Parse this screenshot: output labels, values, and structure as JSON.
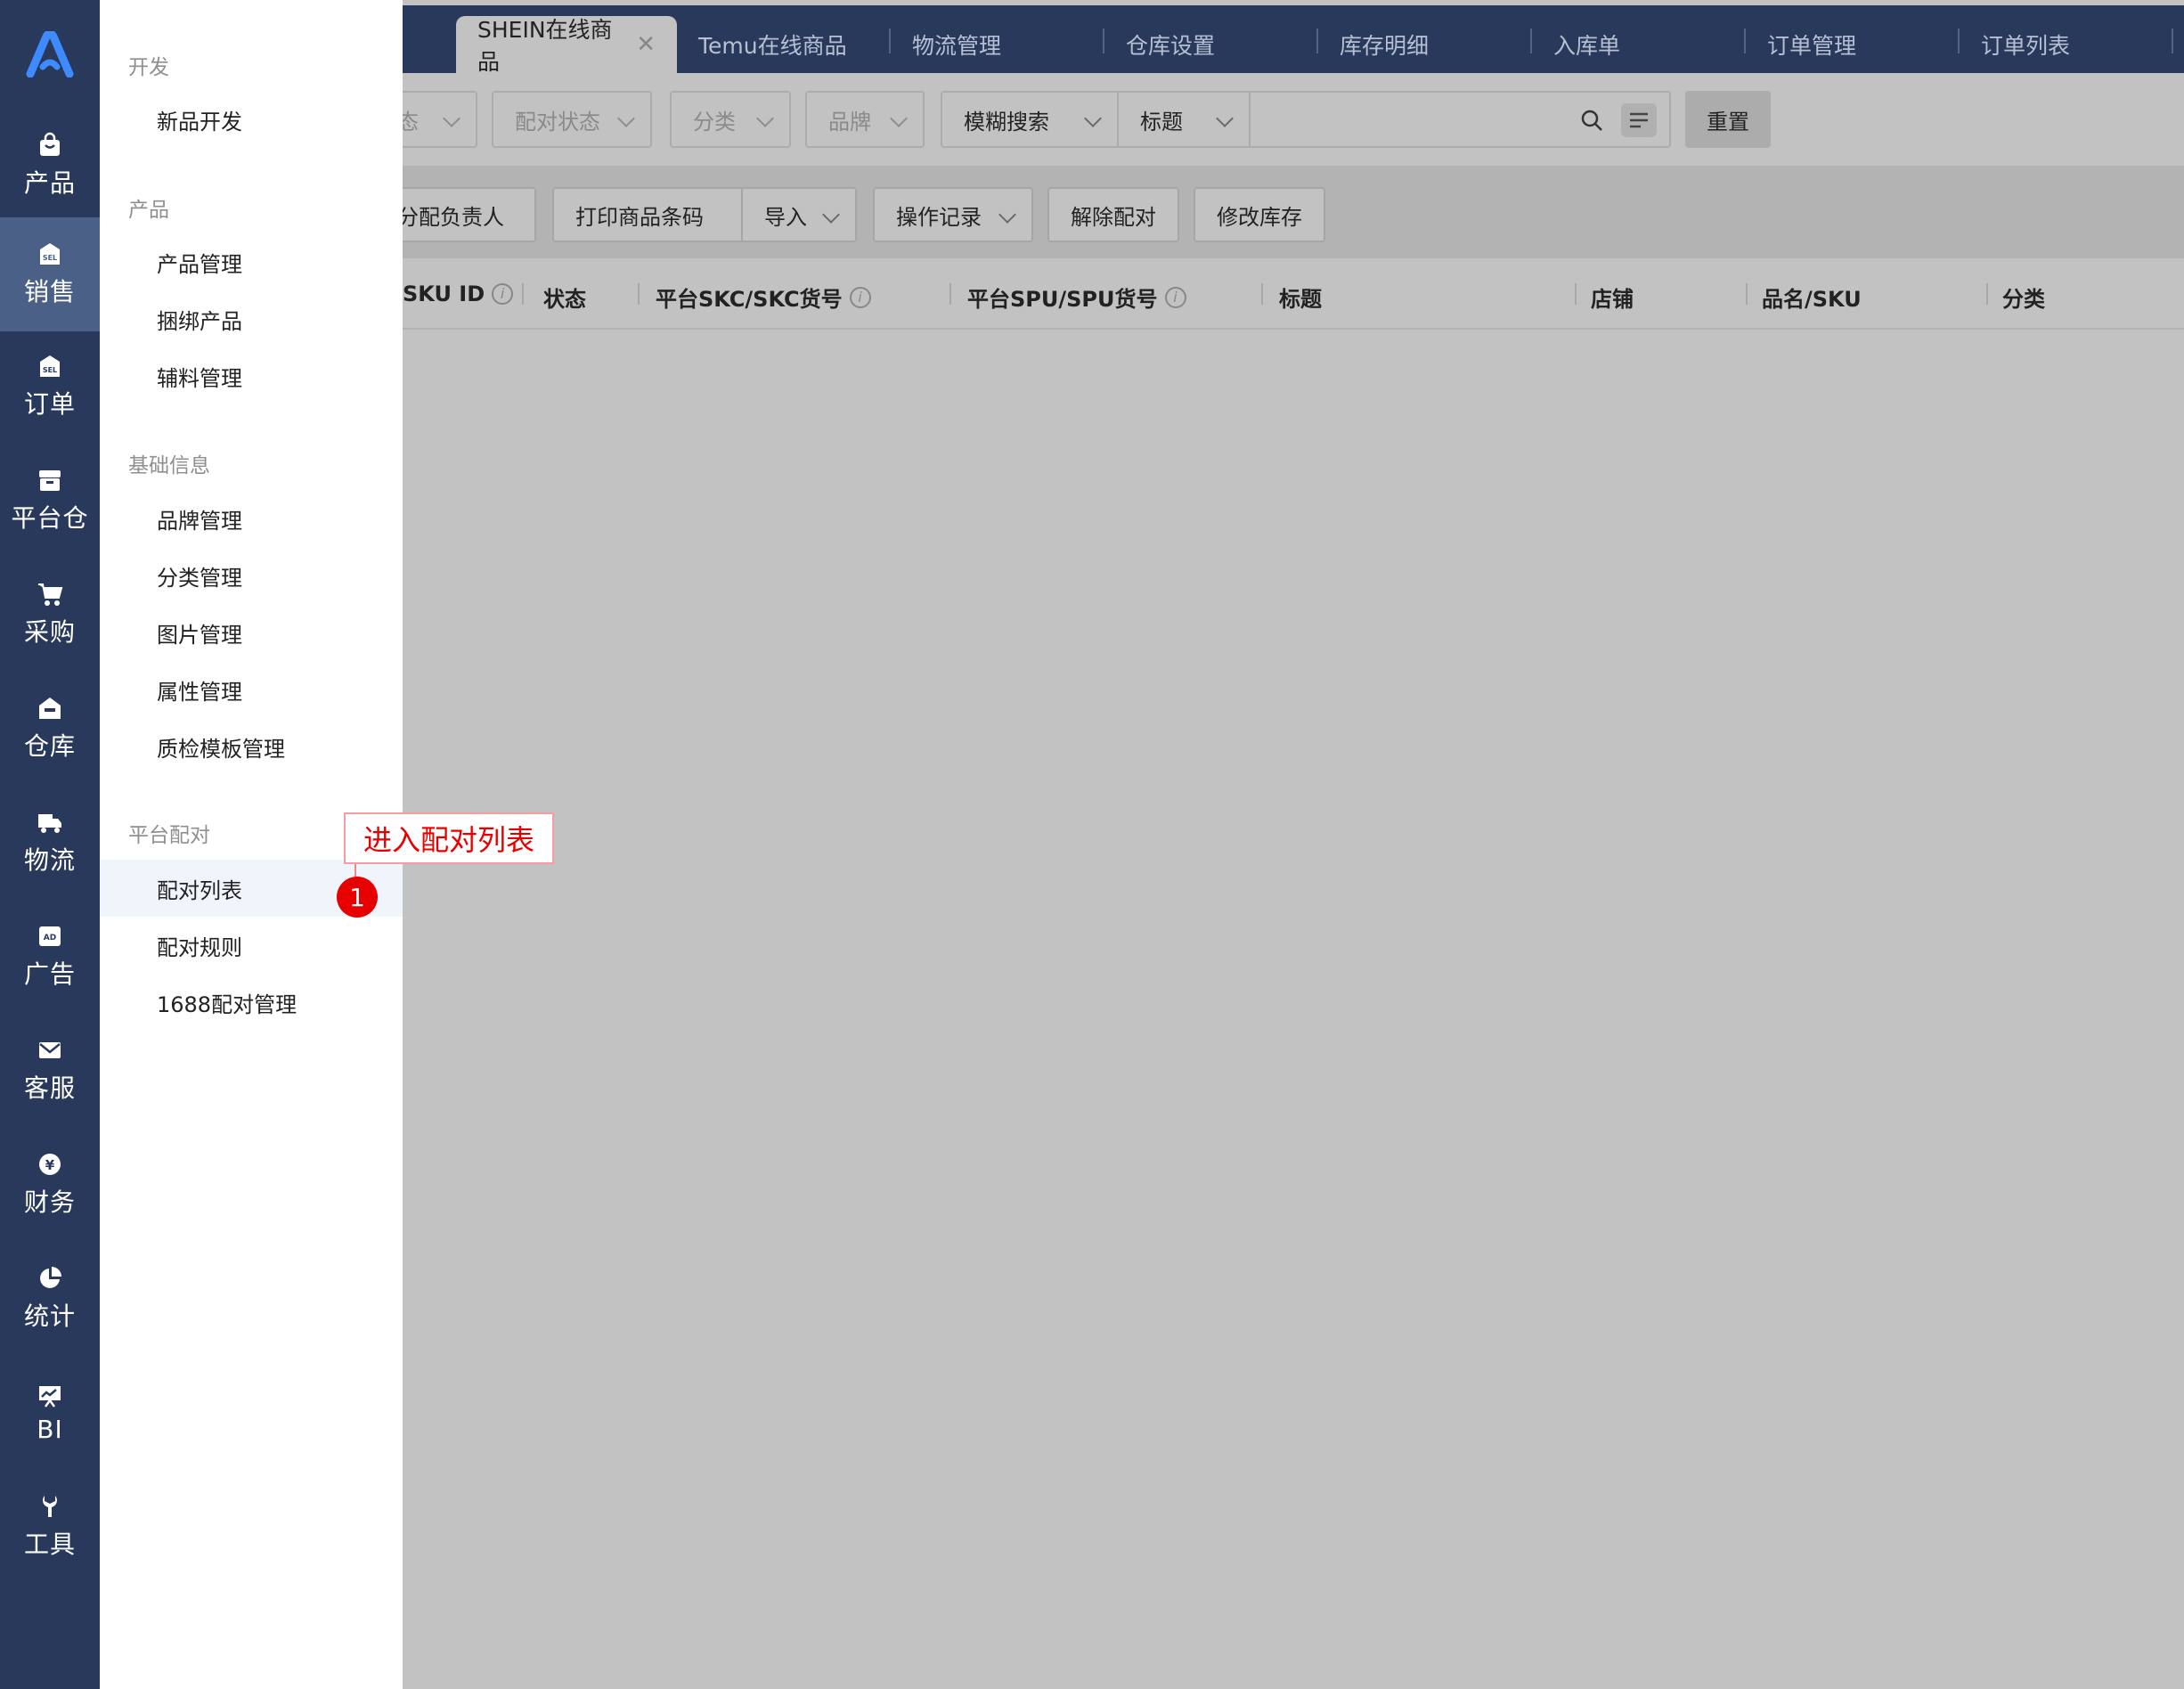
{
  "rail": {
    "items": [
      {
        "label": "产品",
        "icon": "bag-icon"
      },
      {
        "label": "销售",
        "icon": "sell-tag-icon"
      },
      {
        "label": "订单",
        "icon": "sell-tag-icon"
      },
      {
        "label": "平台仓",
        "icon": "archive-box-icon"
      },
      {
        "label": "采购",
        "icon": "cart-icon"
      },
      {
        "label": "仓库",
        "icon": "warehouse-icon"
      },
      {
        "label": "物流",
        "icon": "truck-icon"
      },
      {
        "label": "广告",
        "icon": "ad-icon"
      },
      {
        "label": "客服",
        "icon": "mail-icon"
      },
      {
        "label": "财务",
        "icon": "yen-icon"
      },
      {
        "label": "统计",
        "icon": "pie-chart-icon"
      },
      {
        "label": "BI",
        "icon": "presentation-icon"
      },
      {
        "label": "工具",
        "icon": "wrench-icon"
      }
    ],
    "active": "销售"
  },
  "tabs": [
    {
      "label": "SHEIN在线商品",
      "active": true
    },
    {
      "label": "Temu在线商品"
    },
    {
      "label": "物流管理"
    },
    {
      "label": "仓库设置"
    },
    {
      "label": "库存明细"
    },
    {
      "label": "入库单"
    },
    {
      "label": "订单管理"
    },
    {
      "label": "订单列表"
    }
  ],
  "filters": {
    "status_partial": "态",
    "pair_status": "配对状态",
    "category": "分类",
    "brand": "品牌",
    "fuzzy_search": "模糊搜索",
    "title_field": "标题",
    "search_value": "",
    "reset": "重置"
  },
  "actions": [
    "分配负责人",
    "打印商品条码",
    "导入",
    "操作记录",
    "解除配对",
    "修改库存"
  ],
  "columns": [
    "SKU ID",
    "状态",
    "平台SKC/SKC货号",
    "平台SPU/SPU货号",
    "标题",
    "店铺",
    "品名/SKU",
    "分类"
  ],
  "menu": {
    "groups": [
      {
        "title": "开发",
        "items": [
          "新品开发"
        ]
      },
      {
        "title": "产品",
        "items": [
          "产品管理",
          "捆绑产品",
          "辅料管理"
        ]
      },
      {
        "title": "基础信息",
        "items": [
          "品牌管理",
          "分类管理",
          "图片管理",
          "属性管理",
          "质检模板管理"
        ]
      },
      {
        "title": "平台配对",
        "items": [
          "配对列表",
          "配对规则",
          "1688配对管理"
        ]
      }
    ],
    "active_item": "配对列表"
  },
  "annotation": {
    "text": "进入配对列表",
    "step": "1"
  },
  "colors": {
    "rail_bg": "#28395b",
    "rail_active": "#4b6086",
    "overlay": "#c2c2c2",
    "annotation_red": "#e60000"
  }
}
